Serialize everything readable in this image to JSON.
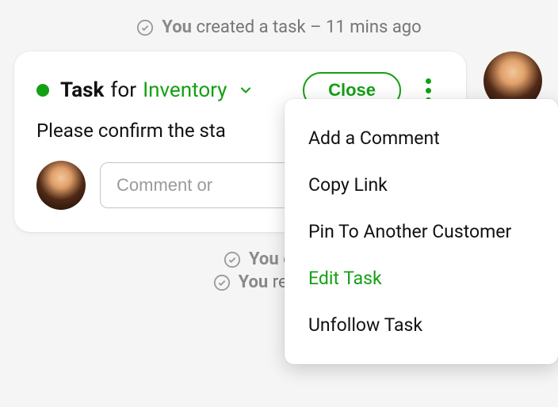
{
  "activities": {
    "top": {
      "who": "You",
      "action": "created a task",
      "time": "11 mins ago"
    },
    "mid": {
      "who": "You",
      "action": "closed"
    },
    "bot": {
      "who": "You",
      "action": "reopened"
    }
  },
  "card": {
    "title_bold": "Task",
    "title_for": "for",
    "category": "Inventory",
    "close_label": "Close",
    "body": "Please confirm the sta",
    "comment_placeholder": "Comment or"
  },
  "menu": {
    "items": [
      {
        "label": "Add a Comment",
        "accent": false
      },
      {
        "label": "Copy Link",
        "accent": false
      },
      {
        "label": "Pin To Another Customer",
        "accent": false
      },
      {
        "label": "Edit Task",
        "accent": true
      },
      {
        "label": "Unfollow Task",
        "accent": false
      }
    ]
  }
}
